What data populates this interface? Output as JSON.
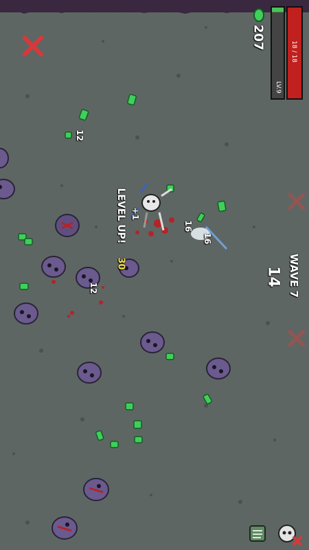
{
  "hud": {
    "materials": "207",
    "hp_text": "18 / 18",
    "hp_fraction": 1.0,
    "level_text": "LV.9",
    "xp_fraction": 0.05,
    "wave_label": "WAVE 7",
    "timer": "14"
  },
  "floating_text": {
    "level_up": "LEVEL UP!",
    "plus_one": "+1",
    "dmg_a": "16",
    "dmg_b": "16",
    "dmg_c": "12",
    "dmg_d": "12",
    "dmg_crit": "30"
  },
  "colors": {
    "hp": "#c0201e",
    "ground": "#5e6663",
    "material": "#3fcf5a",
    "enemy": "#6a5a8e",
    "blood": "#b3242a",
    "close": "#d8383a"
  },
  "icons": {
    "close": "close-x-icon",
    "material": "material-icon",
    "map": "map-icon",
    "skull": "skull-icon"
  }
}
